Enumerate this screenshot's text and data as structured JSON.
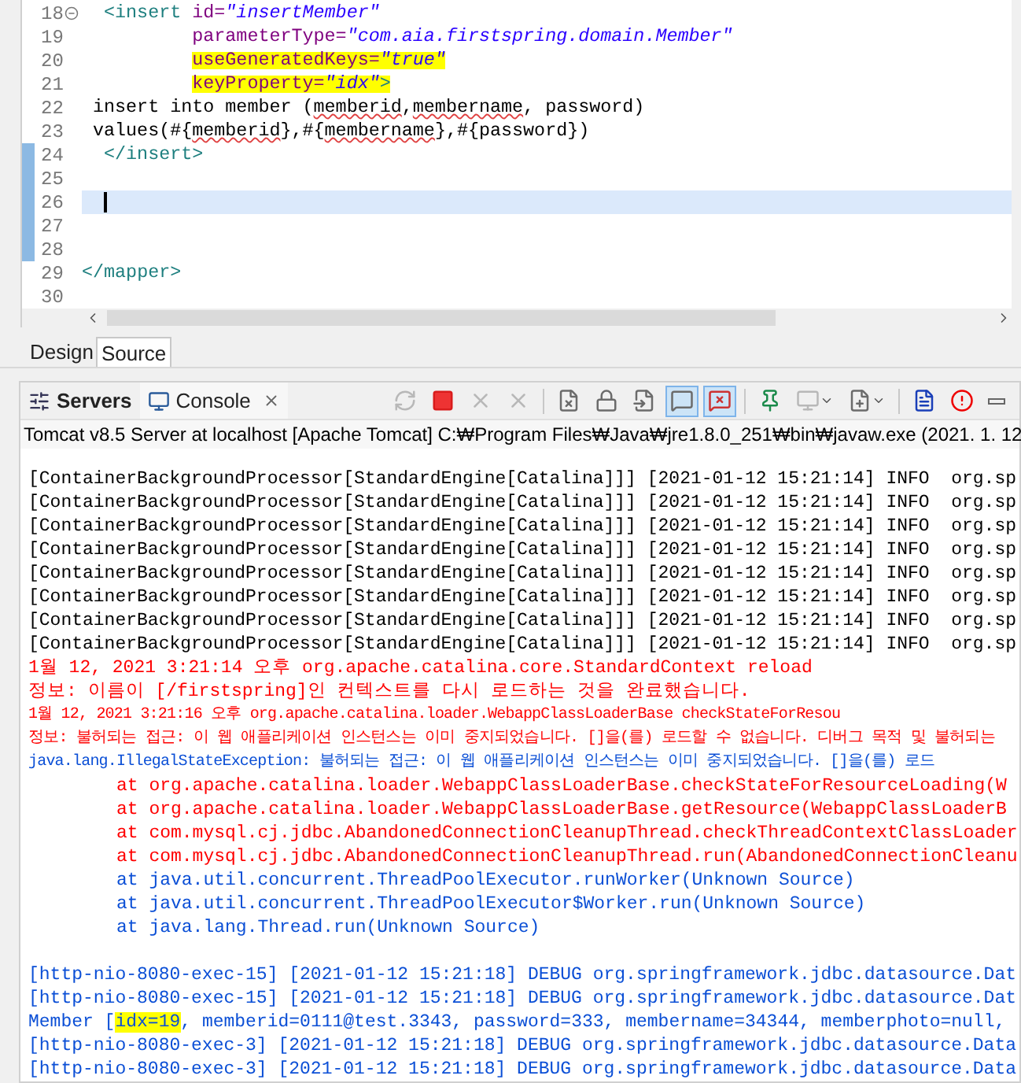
{
  "editor": {
    "lines": [
      {
        "number": "18",
        "kind": "open_tag",
        "fold": true,
        "changed": false,
        "current": false,
        "segments": [
          {
            "text": "<insert ",
            "kind": "tag",
            "highlighted": false,
            "misspelled": false
          },
          {
            "text": "id=",
            "kind": "attr",
            "highlighted": false,
            "misspelled": false
          },
          {
            "text": "\"insertMember\"",
            "kind": "value",
            "highlighted": false,
            "misspelled": false
          }
        ]
      },
      {
        "number": "19",
        "kind": "attribute",
        "fold": false,
        "changed": false,
        "current": false,
        "segments": [
          {
            "text": "parameterType=",
            "kind": "attr",
            "highlighted": false,
            "misspelled": false
          },
          {
            "text": "\"com.aia.firstspring.domain.Member\"",
            "kind": "value",
            "highlighted": false,
            "misspelled": false
          }
        ]
      },
      {
        "number": "20",
        "kind": "attribute",
        "fold": false,
        "changed": false,
        "current": false,
        "segments": [
          {
            "text": "useGeneratedKeys=",
            "kind": "attr",
            "highlighted": true,
            "misspelled": false
          },
          {
            "text": "\"true\"",
            "kind": "value",
            "highlighted": true,
            "misspelled": false
          }
        ]
      },
      {
        "number": "21",
        "kind": "attribute",
        "fold": false,
        "changed": false,
        "current": false,
        "segments": [
          {
            "text": "keyProperty=",
            "kind": "attr",
            "highlighted": true,
            "misspelled": false
          },
          {
            "text": "\"idx\"",
            "kind": "value",
            "highlighted": true,
            "misspelled": false
          },
          {
            "text": ">",
            "kind": "tag",
            "highlighted": true,
            "misspelled": false
          }
        ]
      },
      {
        "number": "22",
        "kind": "statement",
        "fold": false,
        "changed": false,
        "current": false,
        "segments": [
          {
            "text": "insert into member (",
            "kind": "text",
            "highlighted": false,
            "misspelled": false
          },
          {
            "text": "memberid",
            "kind": "text",
            "highlighted": false,
            "misspelled": true
          },
          {
            "text": ",",
            "kind": "text",
            "highlighted": false,
            "misspelled": false
          },
          {
            "text": "membername",
            "kind": "text",
            "highlighted": false,
            "misspelled": true
          },
          {
            "text": ", password)",
            "kind": "text",
            "highlighted": false,
            "misspelled": false
          }
        ]
      },
      {
        "number": "23",
        "kind": "statement",
        "fold": false,
        "changed": false,
        "current": false,
        "segments": [
          {
            "text": "values(#{",
            "kind": "text",
            "highlighted": false,
            "misspelled": false
          },
          {
            "text": "memberid",
            "kind": "text",
            "highlighted": false,
            "misspelled": true
          },
          {
            "text": "},#{",
            "kind": "text",
            "highlighted": false,
            "misspelled": false
          },
          {
            "text": "membername",
            "kind": "text",
            "highlighted": false,
            "misspelled": true
          },
          {
            "text": "},#{password})",
            "kind": "text",
            "highlighted": false,
            "misspelled": false
          }
        ]
      },
      {
        "number": "24",
        "kind": "open_tag",
        "fold": false,
        "changed": true,
        "current": false,
        "segments": [
          {
            "text": "</insert>",
            "kind": "tag",
            "highlighted": false,
            "misspelled": false
          }
        ]
      },
      {
        "number": "25",
        "kind": "open_tag",
        "fold": false,
        "changed": true,
        "current": false
      },
      {
        "number": "26",
        "kind": "open_tag",
        "fold": false,
        "changed": true,
        "current": true
      },
      {
        "number": "27",
        "kind": "open_tag",
        "fold": false,
        "changed": true,
        "current": false
      },
      {
        "number": "28",
        "kind": "open_tag",
        "fold": false,
        "changed": true,
        "current": false
      },
      {
        "number": "29",
        "kind": "root",
        "fold": false,
        "changed": false,
        "current": false,
        "segments": [
          {
            "text": "</mapper>",
            "kind": "tag",
            "highlighted": false,
            "misspelled": false
          }
        ]
      },
      {
        "number": "30",
        "kind": "root",
        "fold": false,
        "changed": false,
        "current": false
      }
    ]
  },
  "editor_tabs": [
    {
      "label": "Design",
      "selected": false
    },
    {
      "label": "Source",
      "selected": true
    }
  ],
  "view_tabs": [
    {
      "label": "Servers",
      "kind": "servers",
      "selected": false
    },
    {
      "label": "Console",
      "kind": "console",
      "selected": true
    }
  ],
  "toolbar": [
    {
      "kind": "relaunch",
      "disabled": true,
      "pressed": false
    },
    {
      "kind": "terminate",
      "disabled": false,
      "pressed": false
    },
    {
      "kind": "remove",
      "disabled": true,
      "pressed": false
    },
    {
      "kind": "remove_all",
      "disabled": true,
      "pressed": false
    },
    {
      "kind": "separator"
    },
    {
      "kind": "clear",
      "disabled": false,
      "pressed": false
    },
    {
      "kind": "scroll_lock",
      "disabled": false,
      "pressed": false
    },
    {
      "kind": "word_wrap",
      "disabled": false,
      "pressed": false
    },
    {
      "kind": "show_stdout",
      "disabled": false,
      "pressed": true
    },
    {
      "kind": "show_stderr",
      "disabled": false,
      "pressed": true
    },
    {
      "kind": "separator"
    },
    {
      "kind": "pin",
      "disabled": false,
      "pressed": false
    },
    {
      "kind": "display",
      "disabled": true,
      "pressed": false
    },
    {
      "kind": "new_console",
      "disabled": false,
      "pressed": false
    },
    {
      "kind": "separator"
    },
    {
      "kind": "open_log",
      "disabled": false,
      "pressed": false
    },
    {
      "kind": "alert",
      "disabled": false,
      "pressed": false
    },
    {
      "kind": "minimize",
      "disabled": false,
      "pressed": false
    }
  ],
  "console": {
    "title": "Tomcat v8.5 Server at localhost [Apache Tomcat] C:₩Program Files₩Java₩jre1.8.0_251₩bin₩javaw.exe  (2021. 1. 12",
    "lines": [
      {
        "kind": "log",
        "text": "[ContainerBackgroundProcessor[StandardEngine[Catalina]]] [2021-01-12 15:21:14] INFO  org.sp"
      },
      {
        "kind": "log",
        "text": "[ContainerBackgroundProcessor[StandardEngine[Catalina]]] [2021-01-12 15:21:14] INFO  org.sp"
      },
      {
        "kind": "log",
        "text": "[ContainerBackgroundProcessor[StandardEngine[Catalina]]] [2021-01-12 15:21:14] INFO  org.sp"
      },
      {
        "kind": "log",
        "text": "[ContainerBackgroundProcessor[StandardEngine[Catalina]]] [2021-01-12 15:21:14] INFO  org.sp"
      },
      {
        "kind": "log",
        "text": "[ContainerBackgroundProcessor[StandardEngine[Catalina]]] [2021-01-12 15:21:14] INFO  org.sp"
      },
      {
        "kind": "log",
        "text": "[ContainerBackgroundProcessor[StandardEngine[Catalina]]] [2021-01-12 15:21:14] INFO  org.sp"
      },
      {
        "kind": "log",
        "text": "[ContainerBackgroundProcessor[StandardEngine[Catalina]]] [2021-01-12 15:21:14] INFO  org.sp"
      },
      {
        "kind": "log",
        "text": "[ContainerBackgroundProcessor[StandardEngine[Catalina]]] [2021-01-12 15:21:14] INFO  org.sp"
      },
      {
        "kind": "error",
        "text": "1월 12, 2021 3:21:14 오후 org.apache.catalina.core.StandardContext reload"
      },
      {
        "kind": "error",
        "text": "정보: 이름이 [/firstspring]인 컨텍스트를 다시 로드하는 것을 완료했습니다."
      },
      {
        "kind": "error_long",
        "text": "1월 12, 2021 3:21:16 오후 org.apache.catalina.loader.WebappClassLoaderBase checkStateForResou"
      },
      {
        "kind": "error_long",
        "text": "정보: 불허되는 접근: 이 웹 애플리케이션 인스턴스는 이미 중지되었습니다. []을(를) 로드할 수 없습니다. 디버그 목적 및 불허되는"
      },
      {
        "kind": "output_long",
        "text": "java.lang.IllegalStateException: 불허되는 접근: 이 웹 애플리케이션 인스턴스는 이미 중지되었습니다. []을(를) 로드"
      },
      {
        "kind": "error_trace",
        "text": "at org.apache.catalina.loader.WebappClassLoaderBase.checkStateForResourceLoading(W"
      },
      {
        "kind": "error_trace",
        "text": "at org.apache.catalina.loader.WebappClassLoaderBase.getResource(WebappClassLoaderB"
      },
      {
        "kind": "error_trace",
        "text": "at com.mysql.cj.jdbc.AbandonedConnectionCleanupThread.checkThreadContextClassLoader"
      },
      {
        "kind": "error_trace",
        "text": "at com.mysql.cj.jdbc.AbandonedConnectionCleanupThread.run(AbandonedConnectionCleanu"
      },
      {
        "kind": "output_trace",
        "text": "at java.util.concurrent.ThreadPoolExecutor.runWorker(Unknown Source)"
      },
      {
        "kind": "output_trace",
        "text": "at java.util.concurrent.ThreadPoolExecutor$Worker.run(Unknown Source)"
      },
      {
        "kind": "output_trace",
        "text": "at java.lang.Thread.run(Unknown Source)"
      },
      {
        "kind": "blank"
      },
      {
        "kind": "output",
        "text": "[http-nio-8080-exec-15] [2021-01-12 15:21:18] DEBUG org.springframework.jdbc.datasource.Dat"
      },
      {
        "kind": "output",
        "text": "[http-nio-8080-exec-15] [2021-01-12 15:21:18] DEBUG org.springframework.jdbc.datasource.Dat"
      },
      {
        "kind": "output_marked",
        "before": "Member [",
        "marked": "idx=19",
        "after": ", memberid=0111@test.3343, password=333, membername=34344, memberphoto=null,"
      },
      {
        "kind": "output",
        "text": "[http-nio-8080-exec-3] [2021-01-12 15:21:18] DEBUG org.springframework.jdbc.datasource.Data"
      },
      {
        "kind": "output",
        "text": "[http-nio-8080-exec-3] [2021-01-12 15:21:18] DEBUG org.springframework.jdbc.datasource.Data"
      }
    ]
  }
}
